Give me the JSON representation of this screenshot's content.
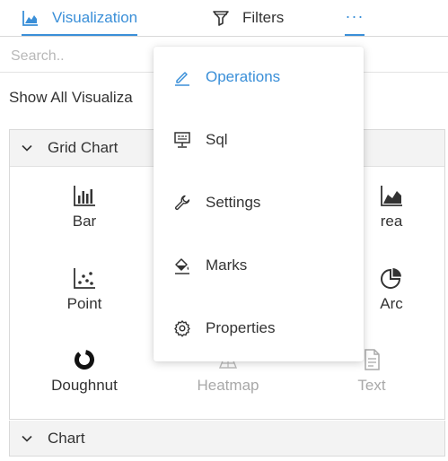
{
  "tabs": [
    {
      "label": "Visualization",
      "icon": "area-chart-icon",
      "active": true
    },
    {
      "label": "Filters",
      "icon": "filter-icon",
      "active": false
    },
    {
      "label": "···",
      "icon": "more-icon",
      "active": false
    }
  ],
  "search": {
    "placeholder": "Search.."
  },
  "show_all": "Show All Visualiza",
  "panel": {
    "title": "Grid Chart",
    "items": [
      {
        "label": "Bar",
        "icon": "bar-chart-icon",
        "enabled": true
      },
      {
        "label": "rea",
        "icon": "area-chart-icon",
        "enabled": true
      },
      {
        "label": "Point",
        "icon": "scatter-plot-icon",
        "enabled": true
      },
      {
        "label": "Arc",
        "icon": "pie-chart-icon",
        "enabled": true
      },
      {
        "label": "Doughnut",
        "icon": "doughnut-chart-icon",
        "enabled": true
      },
      {
        "label": "Heatmap",
        "icon": "heatmap-icon",
        "enabled": false
      },
      {
        "label": "Text",
        "icon": "text-document-icon",
        "enabled": false
      }
    ]
  },
  "second_panel": {
    "title": "Chart"
  },
  "menu": {
    "items": [
      {
        "label": "Operations",
        "icon": "pencil-icon",
        "active": true
      },
      {
        "label": "Sql",
        "icon": "sql-monitor-icon",
        "active": false
      },
      {
        "label": "Settings",
        "icon": "wrench-icon",
        "active": false
      },
      {
        "label": "Marks",
        "icon": "paint-bucket-icon",
        "active": false
      },
      {
        "label": "Properties",
        "icon": "gear-icon",
        "active": false
      }
    ]
  },
  "colors": {
    "accent": "#3a8fd8",
    "text": "#333333",
    "disabled": "#a8a8a8",
    "panel_header_bg": "#f3f3f3"
  }
}
